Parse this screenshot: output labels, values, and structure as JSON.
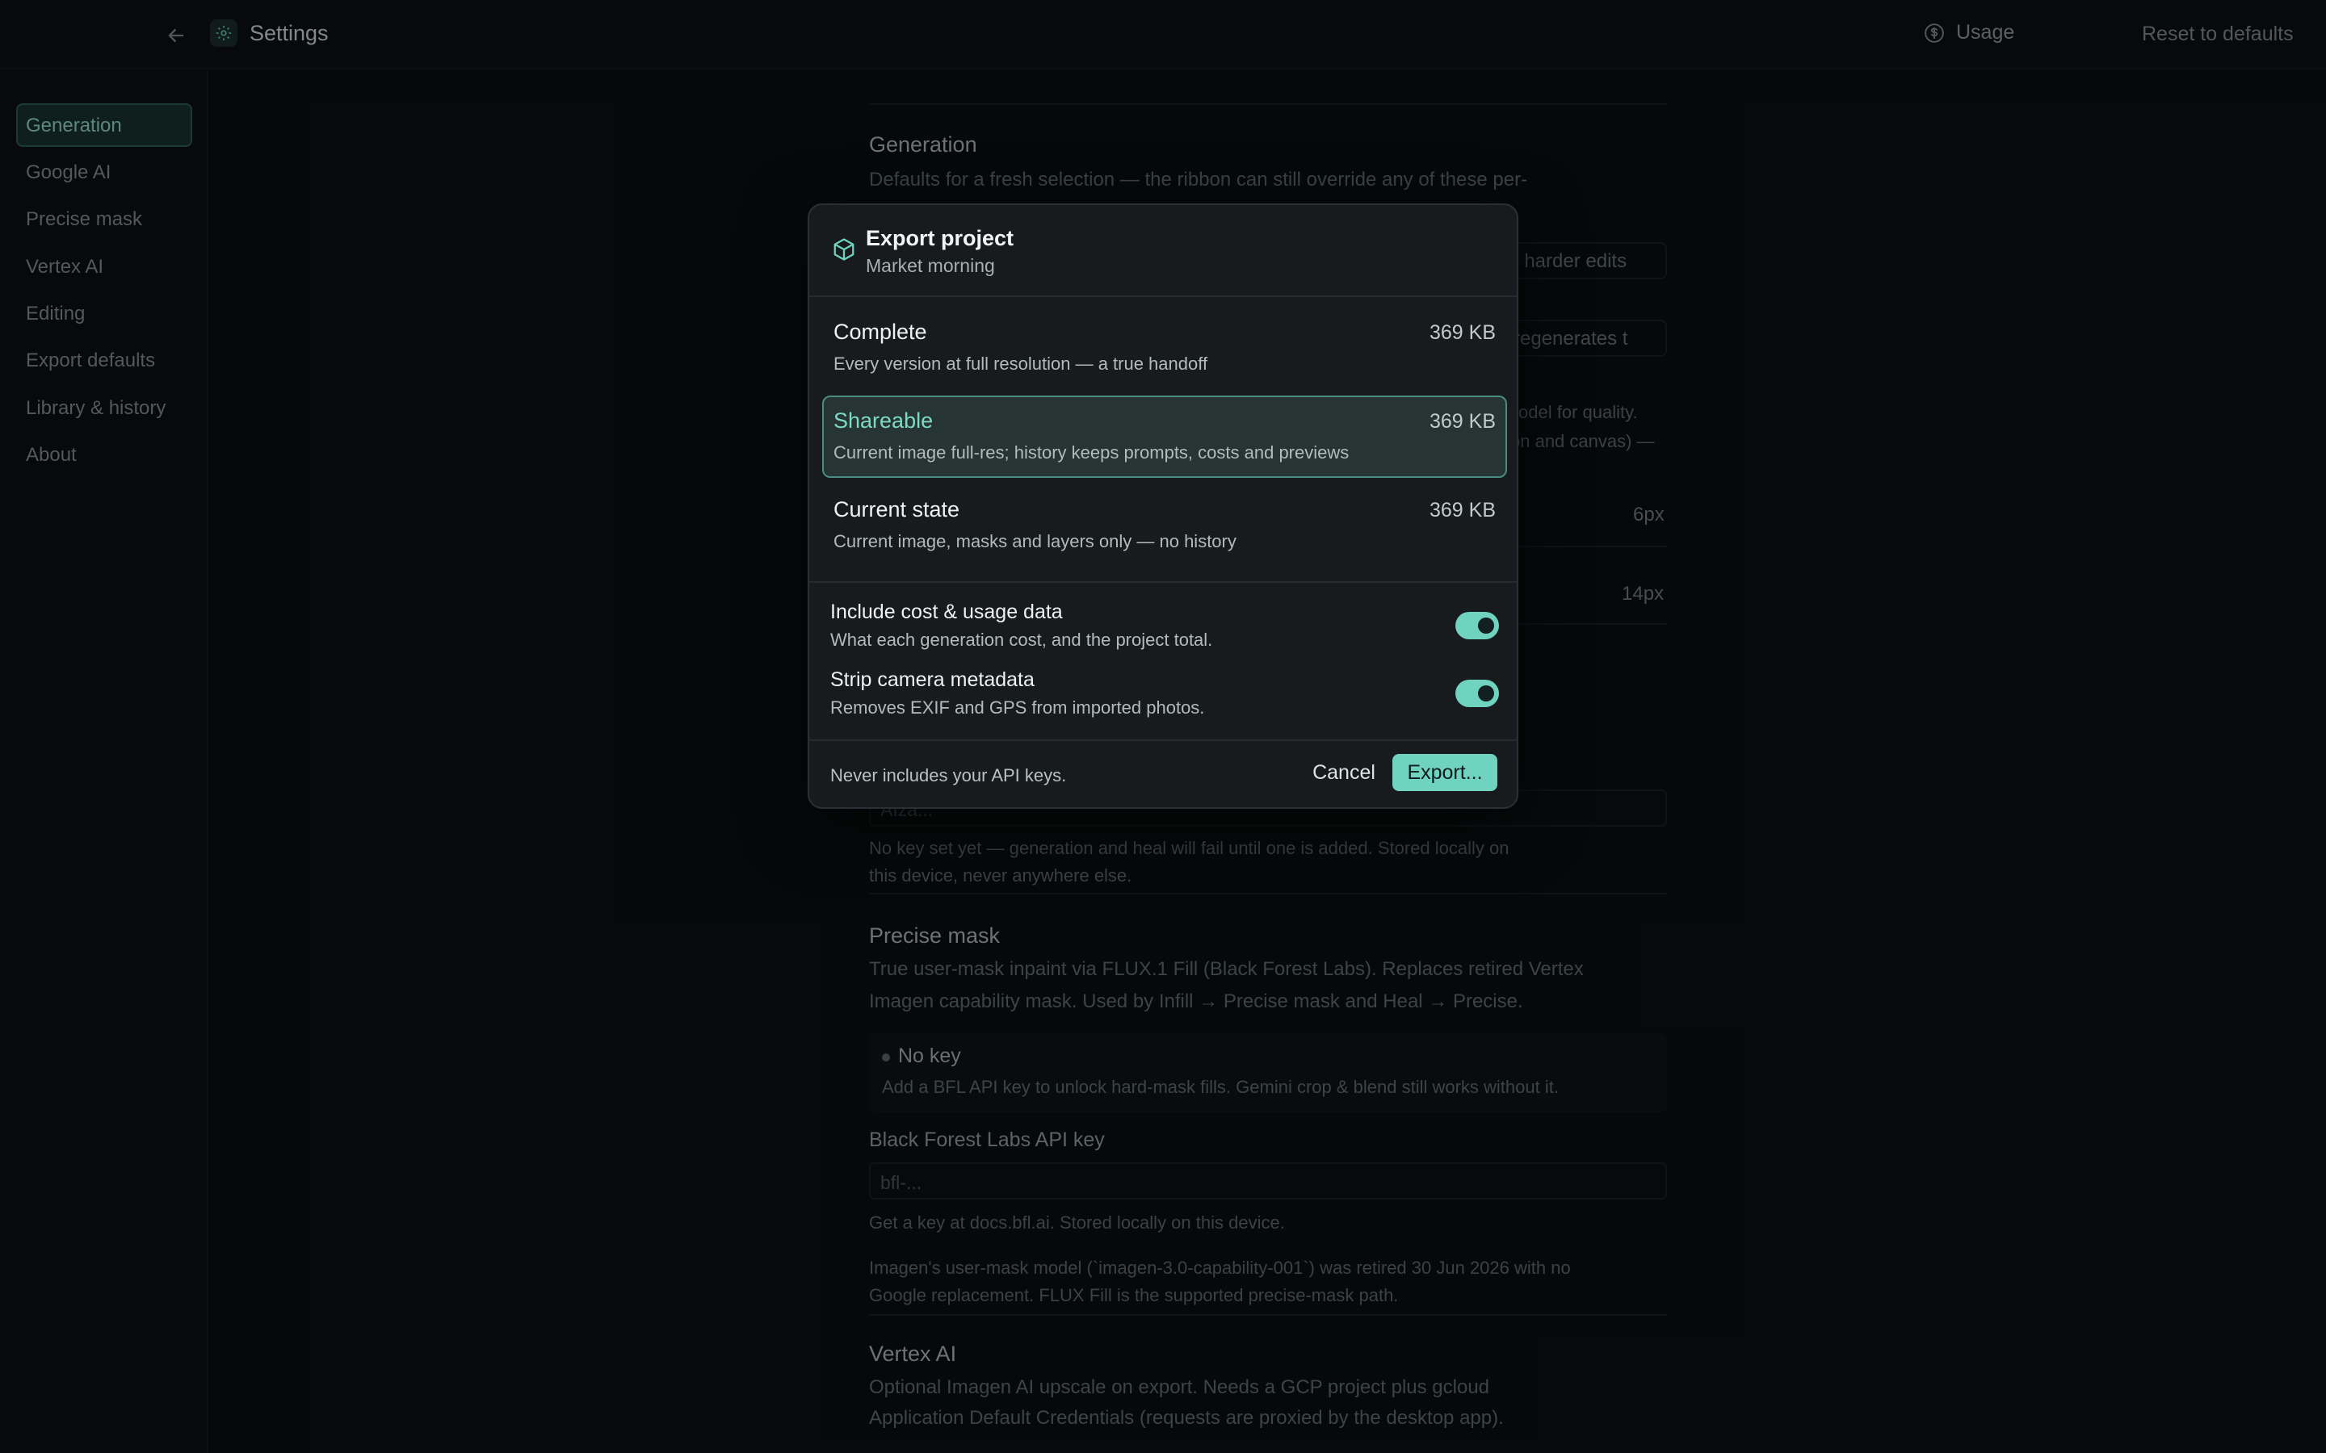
{
  "app": {
    "title": "Settings",
    "usage_label": "Usage",
    "reset_label": "Reset to defaults"
  },
  "sidebar": {
    "items": [
      {
        "label": "Generation",
        "active": true
      },
      {
        "label": "Google AI"
      },
      {
        "label": "Precise mask"
      },
      {
        "label": "Vertex AI"
      },
      {
        "label": "Editing"
      },
      {
        "label": "Export defaults"
      },
      {
        "label": "Library & history"
      },
      {
        "label": "About"
      }
    ]
  },
  "background": {
    "generation": {
      "title": "Generation",
      "desc": "Defaults for a fresh selection — the ribbon can still override any of these per-",
      "select1": ", harder edits",
      "select2": "regenerates t",
      "desc_fragment1": "odel for quality.",
      "desc_fragment2": "on and canvas) —",
      "value1": "6px",
      "value2": "14px"
    },
    "google_ai": {
      "key_placeholder": "AIza...",
      "key_help_line1": "No key set yet — generation and heal will fail until one is added. Stored locally on",
      "key_help_line2": "this device, never anywhere else."
    },
    "precise_mask": {
      "title": "Precise mask",
      "desc_line1": "True user-mask inpaint via FLUX.1 Fill (Black Forest Labs). Replaces retired Vertex",
      "desc_line2": "Imagen capability mask. Used by Infill → Precise mask and Heal → Precise.",
      "notice_title": "No key",
      "notice_desc": "Add a BFL API key to unlock hard-mask fills. Gemini crop & blend still works without it.",
      "key_label": "Black Forest Labs API key",
      "key_placeholder": "bfl-...",
      "key_help": "Get a key at docs.bfl.ai. Stored locally on this device.",
      "note_line1": "Imagen's user-mask model (`imagen-3.0-capability-001`) was retired 30 Jun 2026 with no",
      "note_line2": "Google replacement. FLUX Fill is the supported precise-mask path."
    },
    "vertex_ai": {
      "title": "Vertex AI",
      "desc_line1": "Optional Imagen AI upscale on export. Needs a GCP project plus gcloud",
      "desc_line2": "Application Default Credentials (requests are proxied by the desktop app)."
    }
  },
  "modal": {
    "title": "Export project",
    "subtitle": "Market morning",
    "options": [
      {
        "title": "Complete",
        "desc": "Every version at full resolution — a true handoff",
        "size": "369 KB",
        "selected": false
      },
      {
        "title": "Shareable",
        "desc": "Current image full-res; history keeps prompts, costs and previews",
        "size": "369 KB",
        "selected": true
      },
      {
        "title": "Current state",
        "desc": "Current image, masks and layers only — no history",
        "size": "369 KB",
        "selected": false
      }
    ],
    "toggles": [
      {
        "title": "Include cost & usage data",
        "desc": "What each generation cost, and the project total.",
        "on": true
      },
      {
        "title": "Strip camera metadata",
        "desc": "Removes EXIF and GPS from imported photos.",
        "on": true
      }
    ],
    "footer_note": "Never includes your API keys.",
    "cancel_label": "Cancel",
    "export_label": "Export..."
  },
  "colors": {
    "accent": "#6fd3bf",
    "background": "#0a0e10",
    "modal": "#171b1e"
  }
}
